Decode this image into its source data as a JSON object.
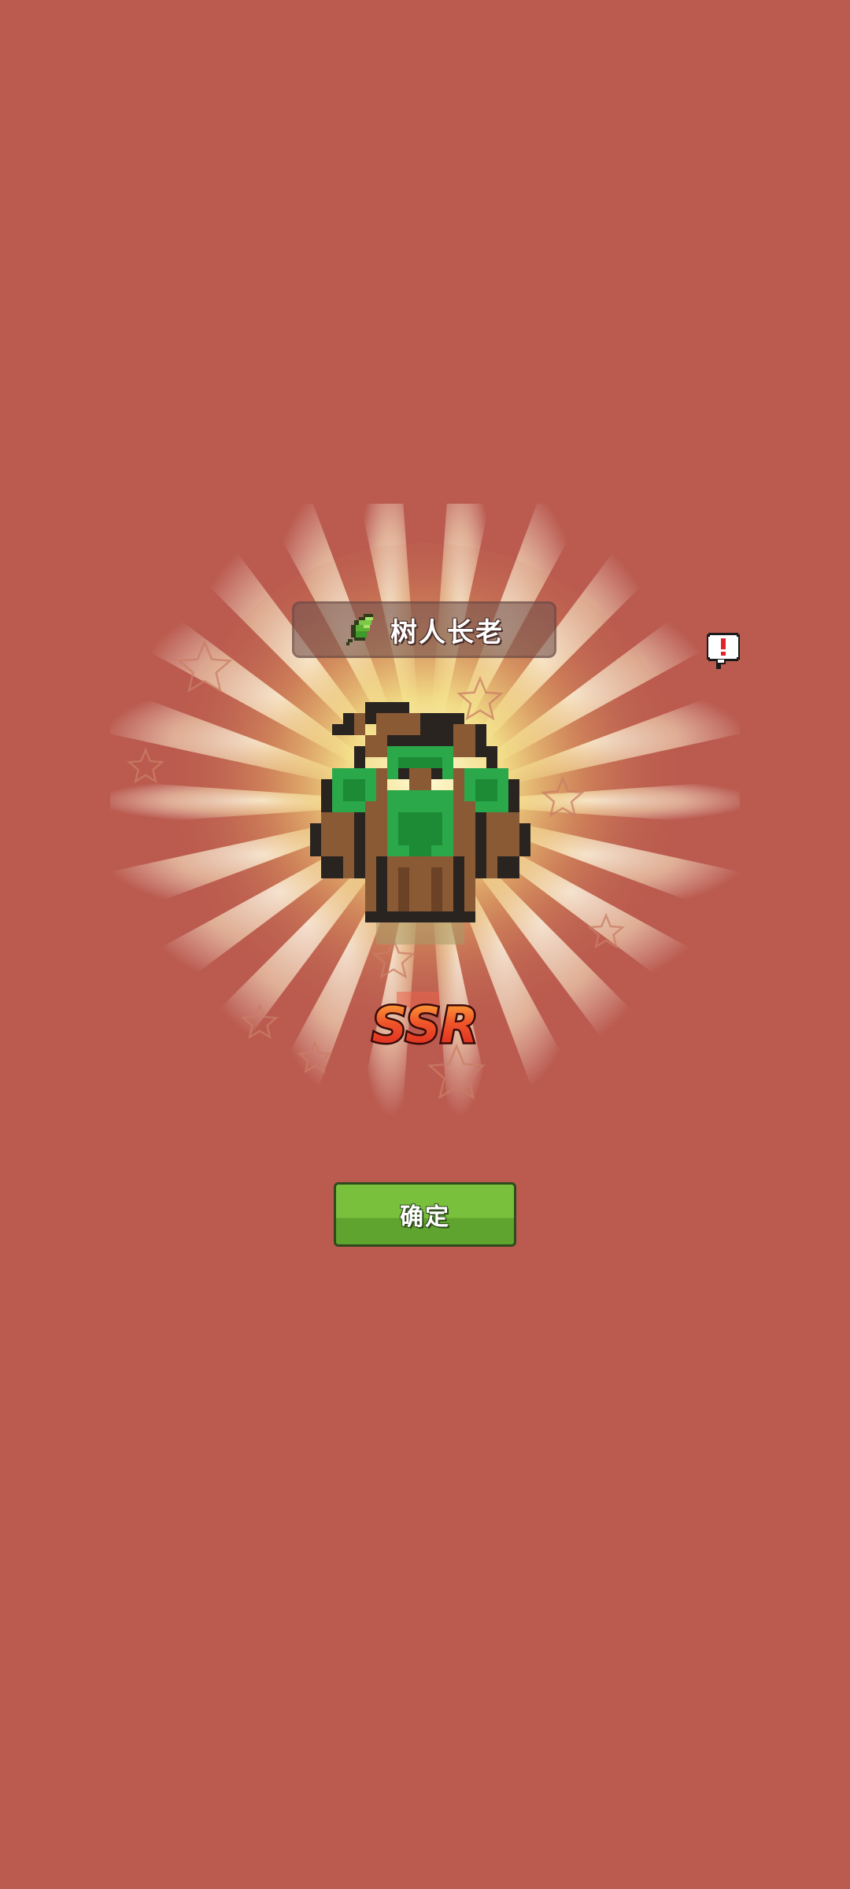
{
  "screen": {
    "background_color": "#bb5b4f",
    "burst_color": "#fff7c8"
  },
  "hero": {
    "name": "树人长老",
    "element_icon": "leaf-icon",
    "sprite_icon": "treant-elder-sprite"
  },
  "rarity": {
    "label": "SSR",
    "color": "#e83a2c"
  },
  "alert": {
    "icon": "exclamation-bubble-icon",
    "color": "#e0242a"
  },
  "confirm_button": {
    "label": "确定",
    "color": "#6fb83a"
  }
}
